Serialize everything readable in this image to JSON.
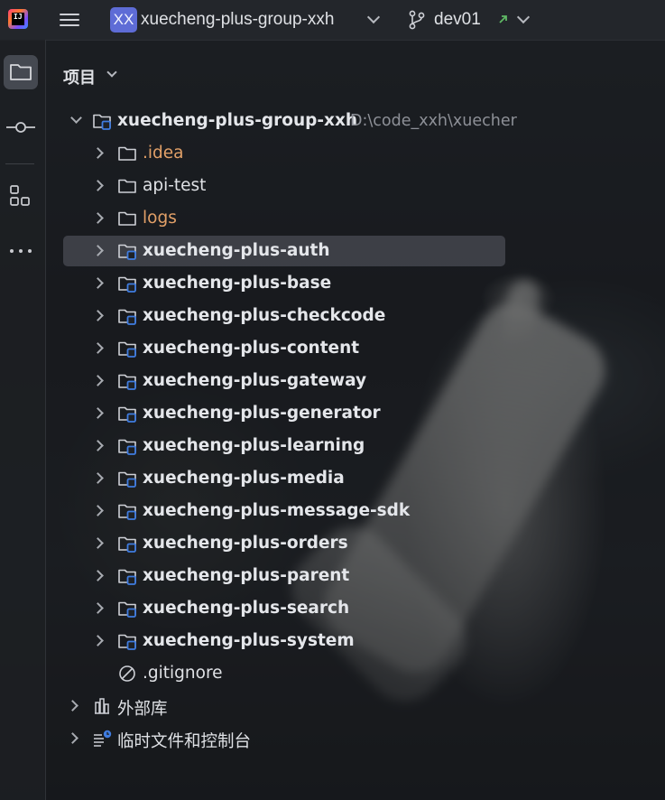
{
  "topbar": {
    "app_logo_text": "IJ",
    "project_badge": "XX",
    "project_name": "xuecheng-plus-group-xxh",
    "branch_name": "dev01"
  },
  "panel": {
    "title": "项目"
  },
  "tree": {
    "root": {
      "label": "xuecheng-plus-group-xxh",
      "path": "D:\\code_xxh\\xuecher"
    },
    "items": [
      {
        "label": ".idea",
        "kind": "folder-excluded"
      },
      {
        "label": "api-test",
        "kind": "folder"
      },
      {
        "label": "logs",
        "kind": "folder-excluded"
      },
      {
        "label": "xuecheng-plus-auth",
        "kind": "module"
      },
      {
        "label": "xuecheng-plus-base",
        "kind": "module"
      },
      {
        "label": "xuecheng-plus-checkcode",
        "kind": "module"
      },
      {
        "label": "xuecheng-plus-content",
        "kind": "module"
      },
      {
        "label": "xuecheng-plus-gateway",
        "kind": "module"
      },
      {
        "label": "xuecheng-plus-generator",
        "kind": "module"
      },
      {
        "label": "xuecheng-plus-learning",
        "kind": "module"
      },
      {
        "label": "xuecheng-plus-media",
        "kind": "module"
      },
      {
        "label": "xuecheng-plus-message-sdk",
        "kind": "module"
      },
      {
        "label": "xuecheng-plus-orders",
        "kind": "module"
      },
      {
        "label": "xuecheng-plus-parent",
        "kind": "module"
      },
      {
        "label": "xuecheng-plus-search",
        "kind": "module"
      },
      {
        "label": "xuecheng-plus-system",
        "kind": "module"
      },
      {
        "label": ".gitignore",
        "kind": "ignore-file"
      }
    ],
    "external_libraries": "外部库",
    "scratches": "临时文件和控制台"
  },
  "colors": {
    "module_badge": "#3f7ce0",
    "excluded_text": "#e2a068",
    "selected_row": "#4b4e56",
    "branch_arrow": "#5fb865"
  }
}
